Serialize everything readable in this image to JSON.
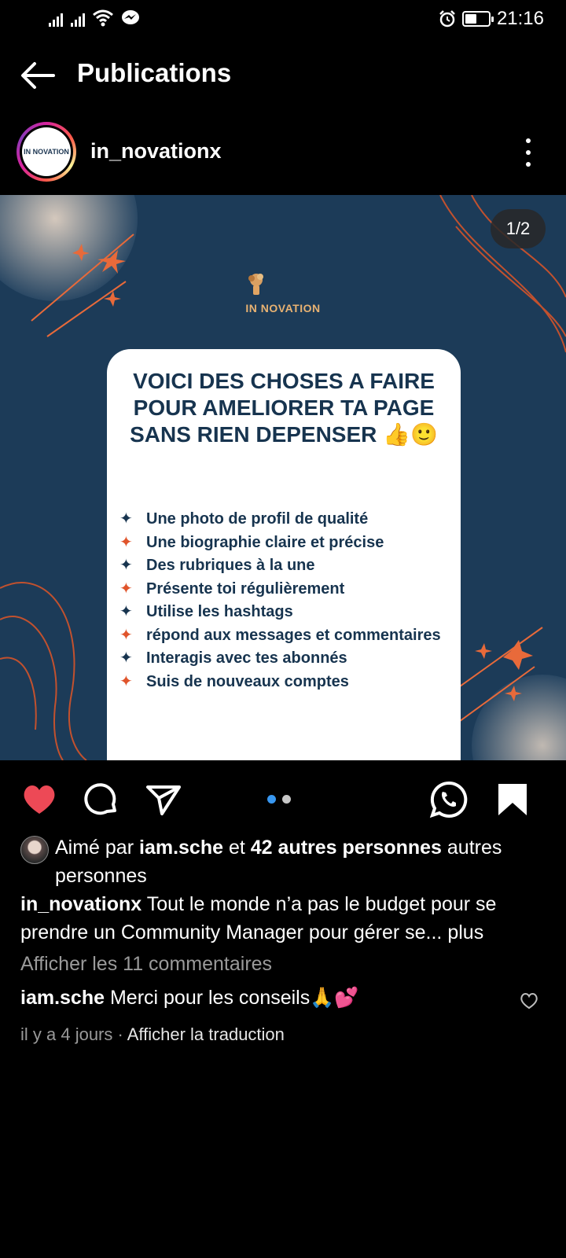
{
  "status_bar": {
    "time": "21:16",
    "battery_level": 0.5
  },
  "header": {
    "title": "Publications"
  },
  "post": {
    "username": "in_novationx",
    "avatar_text": "IN NOVATION",
    "counter": "1/2",
    "image": {
      "logo_text": "IN NOVATION",
      "title": "VOICI DES CHOSES A FAIRE POUR AMELIORER TA PAGE SANS RIEN DEPENSER",
      "title_emoji": "👍🙂",
      "items": [
        "Une photo de profil de qualité",
        "Une biographie claire et précise",
        "Des rubriques à la une",
        "Présente toi régulièrement",
        "Utilise les hashtags",
        "répond aux messages et commentaires",
        "Interagis avec tes abonnés",
        "Suis de nouveaux comptes"
      ]
    },
    "carousel": {
      "count": 2,
      "active_index": 0
    },
    "likes": {
      "prefix": "Aimé par",
      "user": "iam.sche",
      "middle": "et",
      "others": "42 autres personnes",
      "suffix": "autres personnes"
    },
    "caption": {
      "username": "in_novationx",
      "text": "Tout le monde n’a pas le budget pour se prendre un Community  Manager pour gérer se...",
      "more": "plus"
    },
    "view_comments": "Afficher les 11 commentaires",
    "comment": {
      "username": "iam.sche",
      "text": "Merci pour les conseils🙏💕"
    },
    "meta": {
      "time": "il y a 4 jours",
      "separator": "·",
      "translate": "Afficher la traduction"
    }
  },
  "colors": {
    "like_red": "#ed4956",
    "dot_active": "#3897f0",
    "dot_inactive": "#c7c7c7",
    "post_bg": "#1c3b58",
    "card_text": "#17344f",
    "star_dark": "#17344f",
    "star_orange": "#e0542b"
  }
}
